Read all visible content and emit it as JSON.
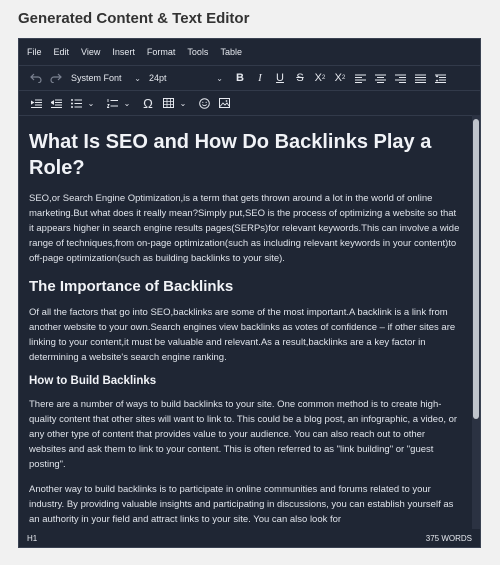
{
  "page_title": "Generated Content & Text Editor",
  "menu": [
    "File",
    "Edit",
    "View",
    "Insert",
    "Format",
    "Tools",
    "Table"
  ],
  "toolbar": {
    "font_family": "System Font",
    "font_size": "24pt"
  },
  "content": {
    "h1": "What Is SEO and How Do Backlinks Play a Role?",
    "p1": "SEO,or Search Engine Optimization,is a term that gets thrown around a lot in the world of online marketing.But what does it really mean?Simply put,SEO is the process of optimizing a website so that it appears higher in search engine results pages(SERPs)for relevant keywords.This can involve a wide range of techniques,from on-page optimization(such as including relevant keywords in your content)to off-page optimization(such as building backlinks to your site).",
    "h2": "The Importance of Backlinks",
    "p2": "Of all the factors that go into SEO,backlinks are some of the most important.A backlink is a link from another website to your own.Search engines view backlinks as votes of confidence – if other sites are linking to your content,it must be valuable and relevant.As a result,backlinks are a key factor in determining a website's search engine ranking.",
    "h3": "How to Build Backlinks",
    "p3": "There are a number of ways to build backlinks to your site. One common method is to create high-quality content that other sites will want to link to. This could be a blog post, an infographic, a video, or any other type of content that provides value to your audience. You can also reach out to other websites and ask them to link to your content. This is often referred to as \"link building\" or \"guest posting\".",
    "p4": "Another way to build backlinks is to participate in online communities and forums related to your industry. By providing valuable insights and participating in discussions, you can establish yourself as an authority in your field and attract links to your site. You can also look for"
  },
  "status": {
    "path": "H1",
    "word_count": "375 WORDS"
  },
  "colors": {
    "editor_bg": "#1f2634",
    "text": "#e6e9ef"
  }
}
